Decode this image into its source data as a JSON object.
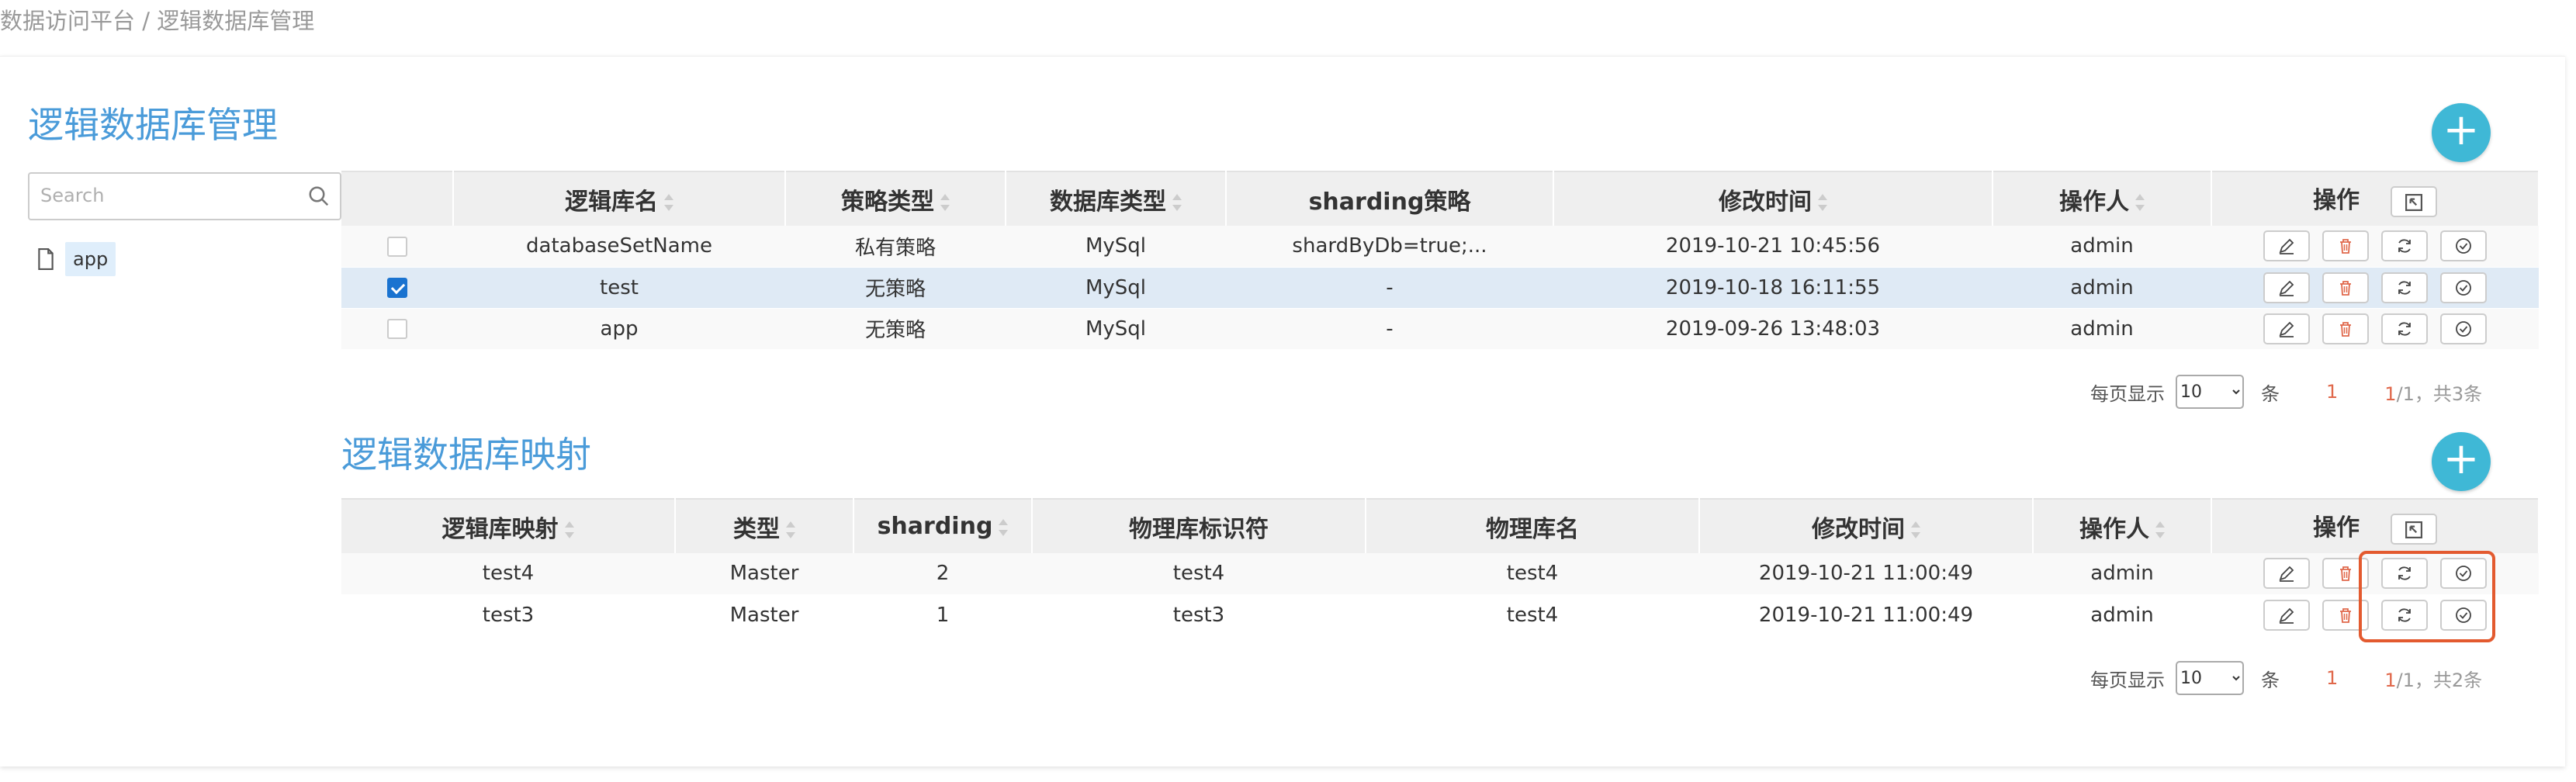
{
  "breadcrumb": "数据访问平台 / 逻辑数据库管理",
  "section1": {
    "title": "逻辑数据库管理",
    "add_label": "+",
    "search_placeholder": "Search",
    "tree_item": "app",
    "columns": [
      "逻辑库名",
      "策略类型",
      "数据库类型",
      "sharding策略",
      "修改时间",
      "操作人",
      "操作"
    ],
    "rows": [
      {
        "checked": false,
        "name": "databaseSetName",
        "strategy": "私有策略",
        "db_type": "MySql",
        "sharding": "shardByDb=true;...",
        "time": "2019-10-21 10:45:56",
        "operator": "admin"
      },
      {
        "checked": true,
        "name": "test",
        "strategy": "无策略",
        "db_type": "MySql",
        "sharding": "-",
        "time": "2019-10-18 16:11:55",
        "operator": "admin"
      },
      {
        "checked": false,
        "name": "app",
        "strategy": "无策略",
        "db_type": "MySql",
        "sharding": "-",
        "time": "2019-09-26 13:48:03",
        "operator": "admin"
      }
    ],
    "pager": {
      "per_page_label": "每页显示",
      "per_page": "10",
      "unit": "条",
      "current": "1",
      "page_num": "1",
      "page_info": "/1，共3条"
    }
  },
  "section2": {
    "title": "逻辑数据库映射",
    "add_label": "+",
    "columns": [
      "逻辑库映射",
      "类型",
      "sharding",
      "物理库标识符",
      "物理库名",
      "修改时间",
      "操作人",
      "操作"
    ],
    "rows": [
      {
        "mapping": "test4",
        "type": "Master",
        "sharding": "2",
        "identifier": "test4",
        "db_name": "test4",
        "time": "2019-10-21 11:00:49",
        "operator": "admin"
      },
      {
        "mapping": "test3",
        "type": "Master",
        "sharding": "1",
        "identifier": "test3",
        "db_name": "test4",
        "time": "2019-10-21 11:00:49",
        "operator": "admin"
      }
    ],
    "pager": {
      "per_page_label": "每页显示",
      "per_page": "10",
      "unit": "条",
      "current": "1",
      "page_num": "1",
      "page_info": "/1，共2条"
    }
  },
  "colors": {
    "accent": "#3fb8d6",
    "title": "#4a9bd9",
    "link": "#2b8ad3",
    "highlight": "#e35a2f",
    "selected_row": "#dfeaf5"
  },
  "icons": [
    "search-icon",
    "file-icon",
    "edit-icon",
    "delete-icon",
    "refresh-icon",
    "check-circle-icon",
    "column-toggle-icon",
    "plus-icon"
  ]
}
